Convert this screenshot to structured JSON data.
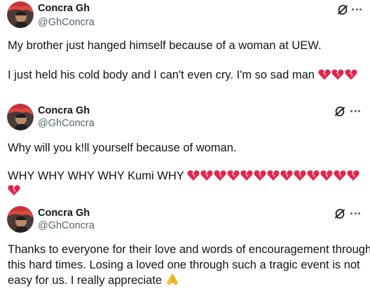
{
  "tweets": [
    {
      "name": "Concra Gh",
      "handle": "@GhConcra",
      "lines": [
        "My brother just hanged himself because of a woman at UEW.",
        "I just held his cold body and I can't even cry. I'm so sad man"
      ],
      "trailing_emoji": [
        "broken-heart",
        "broken-heart",
        "broken-heart"
      ]
    },
    {
      "name": "Concra Gh",
      "handle": "@GhConcra",
      "lines": [
        "Why will you k!ll yourself because of woman.",
        "WHY WHY WHY WHY Kumi WHY"
      ],
      "trailing_emoji_count": 13,
      "wrapped_emoji_count": 1,
      "emoji": "broken-heart"
    },
    {
      "name": "Concra Gh",
      "handle": "@GhConcra",
      "lines": [
        "Thanks to everyone for their love and words of encouragement through",
        "this hard times. Losing a loved one through such a tragic event is not",
        "easy for us. I really appreciate"
      ],
      "trailing_emoji": [
        "folded-hands"
      ]
    }
  ],
  "icons": {
    "grok": "grok-icon",
    "more": "more-options-icon"
  },
  "colors": {
    "text": "#0f1419",
    "secondary": "#536471",
    "heart": "#e2264d"
  }
}
